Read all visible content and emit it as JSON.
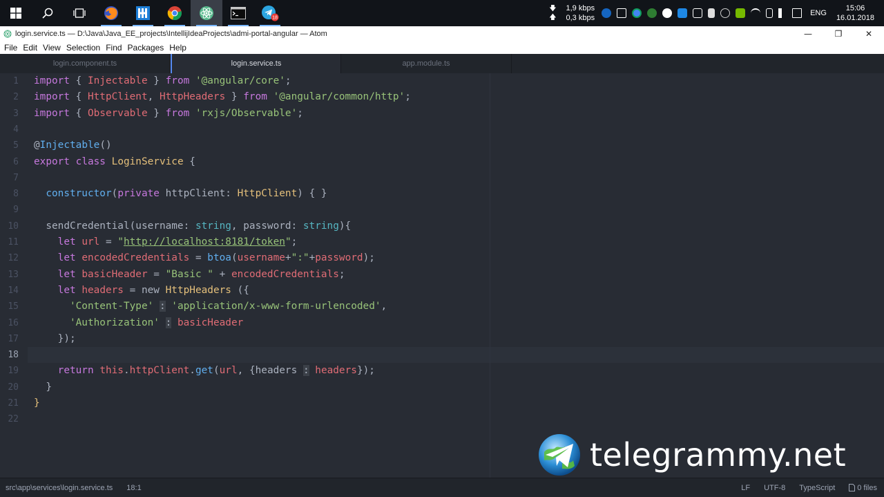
{
  "taskbar": {
    "netspeed": {
      "down": "1,9 kbps",
      "up": "0,3 kbps"
    },
    "language": "ENG",
    "time": "15:06",
    "date": "16.01.2018",
    "telegram_badge": "18"
  },
  "window": {
    "title": "login.service.ts — D:\\Java\\Java_EE_projects\\IntellijIdeaProjects\\admi-portal-angular — Atom",
    "controls": {
      "minimize": "—",
      "maximize": "❐",
      "close": "✕"
    }
  },
  "menu": [
    "File",
    "Edit",
    "View",
    "Selection",
    "Find",
    "Packages",
    "Help"
  ],
  "tabs": [
    {
      "label": "login.component.ts",
      "active": false
    },
    {
      "label": "login.service.ts",
      "active": true
    },
    {
      "label": "app.module.ts",
      "active": false
    }
  ],
  "editor": {
    "current_line": 18,
    "line_numbers": [
      "1",
      "2",
      "3",
      "4",
      "5",
      "6",
      "7",
      "8",
      "9",
      "10",
      "11",
      "12",
      "13",
      "14",
      "15",
      "16",
      "17",
      "18",
      "19",
      "20",
      "21",
      "22"
    ],
    "lines": [
      [
        [
          "kw",
          "import"
        ],
        [
          "pl",
          " { "
        ],
        [
          "var",
          "Injectable"
        ],
        [
          "pl",
          " } "
        ],
        [
          "kw",
          "from"
        ],
        [
          "pl",
          " "
        ],
        [
          "str",
          "'@angular/core'"
        ],
        [
          "pl",
          ";"
        ]
      ],
      [
        [
          "kw",
          "import"
        ],
        [
          "pl",
          " { "
        ],
        [
          "var",
          "HttpClient"
        ],
        [
          "pl",
          ", "
        ],
        [
          "var",
          "HttpHeaders"
        ],
        [
          "pl",
          " } "
        ],
        [
          "kw",
          "from"
        ],
        [
          "pl",
          " "
        ],
        [
          "str",
          "'@angular/common/http'"
        ],
        [
          "pl",
          ";"
        ]
      ],
      [
        [
          "kw",
          "import"
        ],
        [
          "pl",
          " { "
        ],
        [
          "var",
          "Observable"
        ],
        [
          "pl",
          " } "
        ],
        [
          "kw",
          "from"
        ],
        [
          "pl",
          " "
        ],
        [
          "str",
          "'rxjs/Observable'"
        ],
        [
          "pl",
          ";"
        ]
      ],
      [],
      [
        [
          "pl",
          "@"
        ],
        [
          "dec",
          "Injectable"
        ],
        [
          "pl",
          "()"
        ]
      ],
      [
        [
          "kw",
          "export"
        ],
        [
          "pl",
          " "
        ],
        [
          "kw",
          "class"
        ],
        [
          "pl",
          " "
        ],
        [
          "cls",
          "LoginService"
        ],
        [
          "pl",
          " {"
        ]
      ],
      [],
      [
        [
          "pl",
          "  "
        ],
        [
          "fn",
          "constructor"
        ],
        [
          "pl",
          "("
        ],
        [
          "kw",
          "private"
        ],
        [
          "pl",
          " httpClient: "
        ],
        [
          "cls",
          "HttpClient"
        ],
        [
          "pl",
          ") { }"
        ]
      ],
      [],
      [
        [
          "pl",
          "  sendCredential(username: "
        ],
        [
          "op",
          "string"
        ],
        [
          "pl",
          ", password: "
        ],
        [
          "op",
          "string"
        ],
        [
          "pl",
          "){"
        ]
      ],
      [
        [
          "pl",
          "    "
        ],
        [
          "kw",
          "let"
        ],
        [
          "pl",
          " "
        ],
        [
          "var",
          "url"
        ],
        [
          "pl",
          " = "
        ],
        [
          "str",
          "\""
        ],
        [
          "url",
          "http://localhost:8181/token"
        ],
        [
          "str",
          "\""
        ],
        [
          "pl",
          ";"
        ]
      ],
      [
        [
          "pl",
          "    "
        ],
        [
          "kw",
          "let"
        ],
        [
          "pl",
          " "
        ],
        [
          "var",
          "encodedCredentials"
        ],
        [
          "pl",
          " = "
        ],
        [
          "fn",
          "btoa"
        ],
        [
          "pl",
          "("
        ],
        [
          "var",
          "username"
        ],
        [
          "pl",
          "+"
        ],
        [
          "str",
          "\":\""
        ],
        [
          "pl",
          "+"
        ],
        [
          "var",
          "password"
        ],
        [
          "pl",
          ");"
        ]
      ],
      [
        [
          "pl",
          "    "
        ],
        [
          "kw",
          "let"
        ],
        [
          "pl",
          " "
        ],
        [
          "var",
          "basicHeader"
        ],
        [
          "pl",
          " = "
        ],
        [
          "str",
          "\"Basic \""
        ],
        [
          "pl",
          " + "
        ],
        [
          "var",
          "encodedCredentials"
        ],
        [
          "pl",
          ";"
        ]
      ],
      [
        [
          "pl",
          "    "
        ],
        [
          "kw",
          "let"
        ],
        [
          "pl",
          " "
        ],
        [
          "var",
          "headers"
        ],
        [
          "pl",
          " = new "
        ],
        [
          "cls",
          "HttpHeaders"
        ],
        [
          "pl",
          " ({"
        ]
      ],
      [
        [
          "pl",
          "      "
        ],
        [
          "str",
          "'Content-Type'"
        ],
        [
          "pl",
          " "
        ],
        [
          "colon",
          ":"
        ],
        [
          "pl",
          " "
        ],
        [
          "str",
          "'application/x-www-form-urlencoded'"
        ],
        [
          "pl",
          ","
        ]
      ],
      [
        [
          "pl",
          "      "
        ],
        [
          "str",
          "'Authorization'"
        ],
        [
          "pl",
          " "
        ],
        [
          "colon",
          ":"
        ],
        [
          "pl",
          " "
        ],
        [
          "var",
          "basicHeader"
        ]
      ],
      [
        [
          "pl",
          "    });"
        ]
      ],
      [],
      [
        [
          "pl",
          "    "
        ],
        [
          "kw",
          "return"
        ],
        [
          "pl",
          " "
        ],
        [
          "var",
          "this"
        ],
        [
          "pl",
          "."
        ],
        [
          "var",
          "httpClient"
        ],
        [
          "pl",
          "."
        ],
        [
          "fn",
          "get"
        ],
        [
          "pl",
          "("
        ],
        [
          "var",
          "url"
        ],
        [
          "pl",
          ", {headers "
        ],
        [
          "colon",
          ":"
        ],
        [
          "pl",
          " "
        ],
        [
          "var",
          "headers"
        ],
        [
          "pl",
          "});"
        ]
      ],
      [
        [
          "pl",
          "  }"
        ]
      ],
      [
        [
          "cls",
          "}"
        ]
      ],
      []
    ]
  },
  "watermark": {
    "text": "telegrammy.net",
    "icon": "telegram-globe-icon"
  },
  "statusbar": {
    "file_path": "src\\app\\services\\login.service.ts",
    "cursor": "18:1",
    "line_ending": "LF",
    "encoding": "UTF-8",
    "grammar": "TypeScript",
    "git": "0 files"
  },
  "colors": {
    "editor_bg": "#282c34",
    "keyword": "#c678dd",
    "string": "#98c379",
    "variable": "#e06c75",
    "class": "#e5c07b",
    "function": "#61afef",
    "accent": "#568af2"
  }
}
